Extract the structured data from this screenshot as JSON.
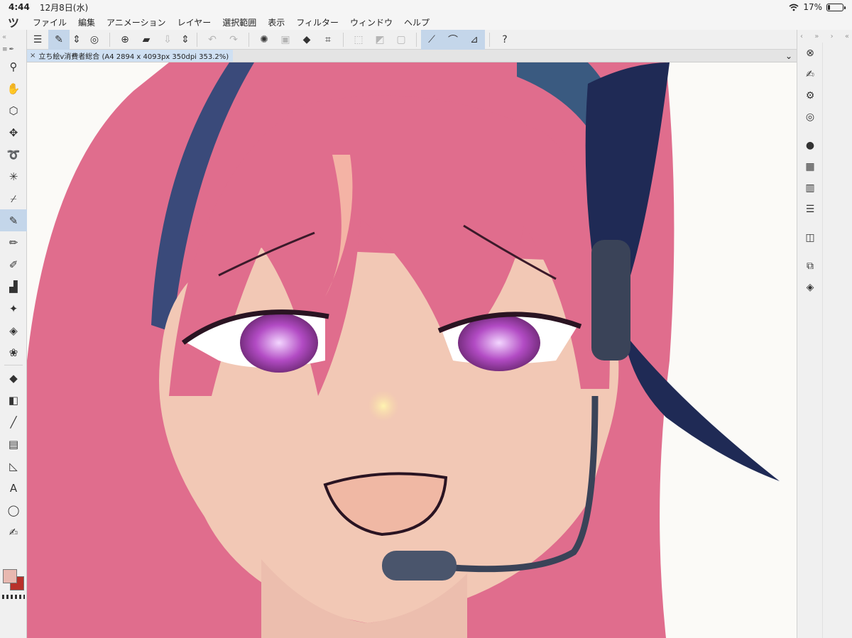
{
  "status_bar": {
    "time": "4:44",
    "date": "12月8日(水)",
    "battery_percent": "17%",
    "battery_level": 0.17
  },
  "menu": {
    "logo": "ツ",
    "items": [
      "ファイル",
      "編集",
      "アニメーション",
      "レイヤー",
      "選択範囲",
      "表示",
      "フィルター",
      "ウィンドウ",
      "ヘルプ"
    ]
  },
  "tab": {
    "close": "×",
    "title": "立ち絵v消費者総合 (A4 2894 x 4093px 350dpi 353.2%)"
  },
  "colors": {
    "main": "#e8b8b0",
    "sub": "#b8302a",
    "hair": "#e06d8d",
    "skin": "#f2c8b5",
    "accent": "#c4d6ea"
  }
}
